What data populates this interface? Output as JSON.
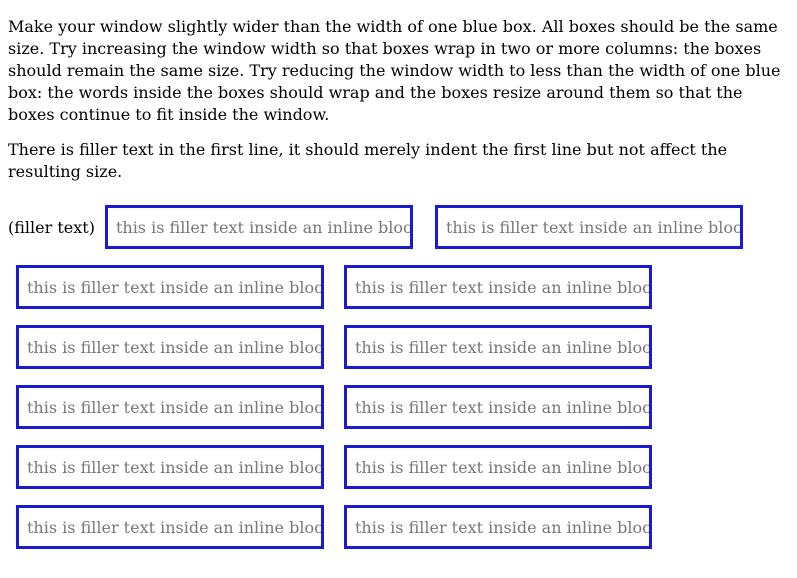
{
  "intro": {
    "paragraph_1": "Make your window slightly wider than the width of one blue box. All boxes should be the same size. Try increasing the window width so that boxes wrap in two or more columns: the boxes should remain the same size. Try reducing the window width to less than the width of one blue box: the words inside the boxes should wrap and the boxes resize around them so that the boxes continue to fit inside the window.",
    "paragraph_2": "There is filler text in the first line, it should merely indent the first line but not affect the resulting size."
  },
  "demo": {
    "leading_filler": "(filler text)",
    "box_text": "this is filler text inside an inline block",
    "box_border_color": "#1a1ad0",
    "box_text_color": "#777777",
    "box_count": 12
  }
}
